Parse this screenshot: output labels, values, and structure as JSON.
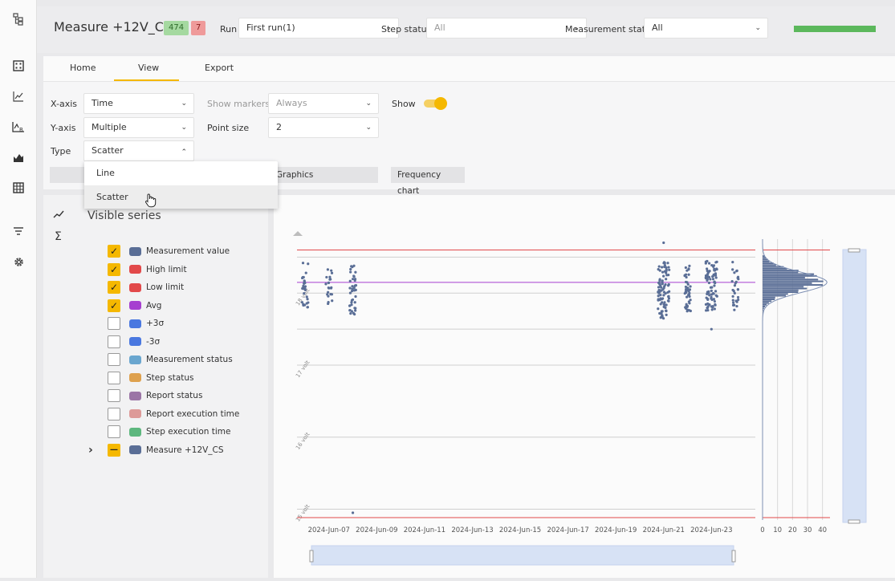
{
  "topbar": {
    "title": "Measure +12V_CS",
    "badge_pass": "474",
    "badge_fail": "7",
    "run_label": "Run",
    "run_value": "First run(1)",
    "step_status_label": "Step status",
    "step_status_value": "All",
    "measurement_status_label": "Measurement status",
    "measurement_status_value": "All",
    "colors": {
      "pass_bg": "#a5d9a0",
      "fail_bg": "#ef9a9a",
      "progress": "#5cb85c"
    },
    "progress_fraction": 1.0
  },
  "tabs": [
    "Home",
    "View",
    "Export"
  ],
  "active_tab": "View",
  "toolbar": {
    "xaxis_label": "X-axis",
    "xaxis_value": "Time",
    "yaxis_label": "Y-axis",
    "yaxis_value": "Multiple",
    "type_label": "Type",
    "type_value": "Scatter",
    "markers_label": "Show markers",
    "markers_value": "Always",
    "pointsize_label": "Point size",
    "pointsize_value": "2",
    "show_label": "Show",
    "show_on": true,
    "subtab_graphics": "Graphics",
    "subtab_frequency": "Frequency chart"
  },
  "dropdown": {
    "items": [
      "Line",
      "Scatter"
    ],
    "hovered": "Scatter"
  },
  "panel": {
    "heading": "Visible series",
    "series": [
      {
        "name": "Measurement value",
        "checked": true,
        "color": "#5a6e96"
      },
      {
        "name": "High limit",
        "checked": true,
        "color": "#e2494a"
      },
      {
        "name": "Low limit",
        "checked": true,
        "color": "#e2494a"
      },
      {
        "name": "Avg",
        "checked": true,
        "color": "#a63fd0"
      },
      {
        "name": "+3σ",
        "checked": false,
        "color": "#4a78e0"
      },
      {
        "name": "-3σ",
        "checked": false,
        "color": "#4a78e0"
      },
      {
        "name": "Measurement status",
        "checked": false,
        "color": "#6aa6cf"
      },
      {
        "name": "Step status",
        "checked": false,
        "color": "#dea14e"
      },
      {
        "name": "Report status",
        "checked": false,
        "color": "#9b75a6"
      },
      {
        "name": "Report execution time",
        "checked": false,
        "color": "#dd9a98"
      },
      {
        "name": "Step execution time",
        "checked": false,
        "color": "#5db77e"
      }
    ],
    "group": {
      "name": "Measure +12V_CS",
      "color": "#5a6e96",
      "state": "partial"
    }
  },
  "chart_data": {
    "type": "scatter",
    "x_dates": [
      "2024-Jun-07",
      "2024-Jun-09",
      "2024-Jun-11",
      "2024-Jun-13",
      "2024-Jun-15",
      "2024-Jun-17",
      "2024-Jun-19",
      "2024-Jun-21",
      "2024-Jun-23"
    ],
    "y_tick_labels": [
      "18 volt",
      "17 volt",
      "16 volt",
      "15 volt"
    ],
    "ylim": [
      14.85,
      18.75
    ],
    "high_limit": 18.6,
    "low_limit": 14.85,
    "avg": 18.15,
    "clusters": [
      {
        "date": "2024-Jun-06",
        "lo": 17.75,
        "hi": 18.45,
        "n": 28
      },
      {
        "date": "2024-Jun-07",
        "lo": 17.85,
        "hi": 18.35,
        "n": 22
      },
      {
        "date": "2024-Jun-08",
        "lo": 17.7,
        "hi": 18.45,
        "n": 40
      },
      {
        "date": "2024-Jun-21",
        "lo": 17.65,
        "hi": 18.45,
        "n": 90
      },
      {
        "date": "2024-Jun-22",
        "lo": 17.75,
        "hi": 18.4,
        "n": 45
      },
      {
        "date": "2024-Jun-23",
        "lo": 17.75,
        "hi": 18.45,
        "n": 80
      },
      {
        "date": "2024-Jun-24",
        "lo": 17.75,
        "hi": 18.45,
        "n": 28
      }
    ],
    "outliers": [
      {
        "date": "2024-Jun-08",
        "y": 14.95
      },
      {
        "date": "2024-Jun-21",
        "y": 18.7
      },
      {
        "date": "2024-Jun-23",
        "y": 17.5
      }
    ],
    "histogram_ticks": [
      "0",
      "10",
      "20",
      "30",
      "40"
    ],
    "histogram_xlim": [
      0,
      45
    ]
  }
}
